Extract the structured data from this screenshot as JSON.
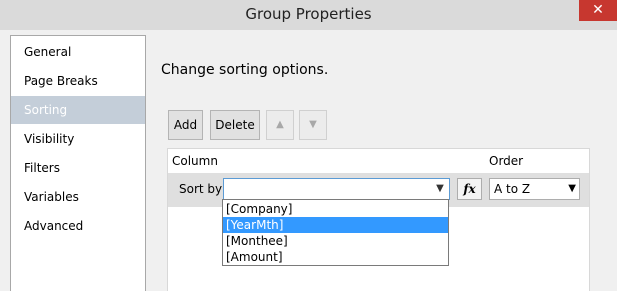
{
  "window": {
    "title": "Group Properties",
    "close_label": "✕"
  },
  "sidebar": {
    "items": [
      {
        "label": "General",
        "selected": false
      },
      {
        "label": "Page Breaks",
        "selected": false
      },
      {
        "label": "Sorting",
        "selected": true
      },
      {
        "label": "Visibility",
        "selected": false
      },
      {
        "label": "Filters",
        "selected": false
      },
      {
        "label": "Variables",
        "selected": false
      },
      {
        "label": "Advanced",
        "selected": false
      }
    ]
  },
  "main": {
    "heading": "Change sorting options.",
    "toolbar": {
      "add_label": "Add",
      "delete_label": "Delete",
      "move_up_icon": "▲",
      "move_down_icon": "▼"
    },
    "grid": {
      "column_header": "Column",
      "order_header": "Order",
      "rows": [
        {
          "label": "Sort by",
          "column_value": "",
          "order_value": "A to Z"
        }
      ],
      "fx_label": "fx"
    },
    "dropdown": {
      "options": [
        "[Company]",
        "[YearMth]",
        "[Monthee]",
        "[Amount]"
      ],
      "highlighted": "[YearMth]"
    }
  },
  "icons": {
    "dropdown_arrow": "▼"
  },
  "colors": {
    "selection_blue": "#3399ff",
    "close_red": "#c7372f",
    "nav_selected": "#c4ced9"
  }
}
